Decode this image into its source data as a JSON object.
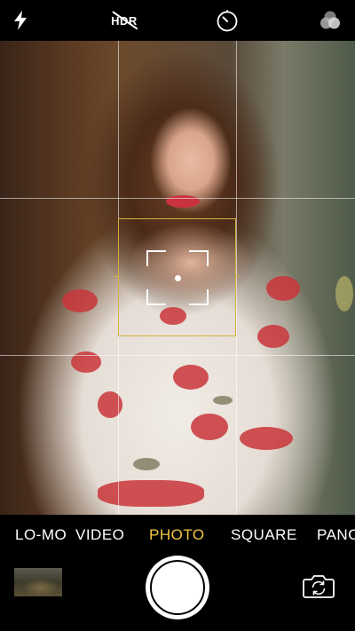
{
  "top_bar": {
    "flash_icon": "lightning-bolt",
    "hdr_label": "HDR",
    "timer_icon": "stopwatch",
    "filters_icon": "three-overlapping-circles"
  },
  "viewfinder": {
    "grid": "rule-of-thirds",
    "focus_indicator": "yellow-square",
    "accent_color": "#d6b23c"
  },
  "modes": {
    "items": [
      "LO-MO",
      "VIDEO",
      "PHOTO",
      "SQUARE",
      "PANO"
    ],
    "active": "PHOTO",
    "active_color": "#f3c641"
  },
  "bottom": {
    "thumbnail": "last-photo-thumbnail",
    "shutter_icon": "shutter-button",
    "flip_icon": "camera-flip"
  }
}
